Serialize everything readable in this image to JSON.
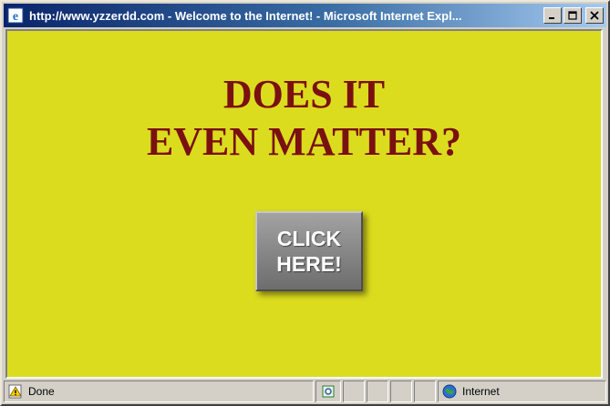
{
  "window": {
    "title": "http://www.yzzerdd.com - Welcome to the Internet! - Microsoft Internet Expl..."
  },
  "page": {
    "headline_line1": "DOES IT",
    "headline_line2": "EVEN MATTER?",
    "button_line1": "CLICK",
    "button_line2": "HERE!"
  },
  "status": {
    "text": "Done",
    "zone": "Internet"
  },
  "colors": {
    "page_background": "#dcdc1e",
    "headline": "#7a1010",
    "button": "#8a8a8a"
  },
  "icons": {
    "title": "ie-logo-icon",
    "status_left": "warning-page-icon",
    "status_mid": "page-icon",
    "zone": "globe-icon"
  }
}
